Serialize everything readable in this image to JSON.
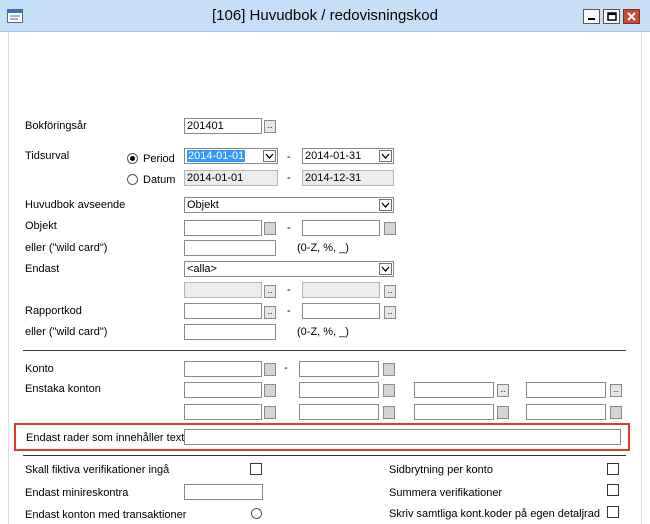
{
  "window": {
    "title": "[106]  Huvudbok / redovisningskod",
    "minimize_icon": "minimize-icon",
    "maximize_icon": "maximize-icon",
    "close_icon": "close-icon",
    "accent": "#c7def7",
    "close_color": "#c94b3a"
  },
  "form": {
    "bokforingsar_label": "Bokföringsår",
    "bokforingsar_value": "201401",
    "tidsurval_label": "Tidsurval",
    "period_label": "Period",
    "datum_label": "Datum",
    "period_from": "2014-01-01",
    "period_to": "2014-01-31",
    "datum_from": "2014-01-01",
    "datum_to": "2014-12-31",
    "huvudbok_label": "Huvudbok avseende",
    "huvudbok_value": "Objekt",
    "objekt_label": "Objekt",
    "wildcard_label": "eller (\"wild card\")",
    "wildcard_hint": "(0-Z, %, _)",
    "endast_label": "Endast",
    "endast_value": "<alla>",
    "rapportkod_label": "Rapportkod",
    "wildcard2_label": "eller (\"wild card\")",
    "wildcard2_hint": "(0-Z, %, _)",
    "dash": "-",
    "dots_label": "..",
    "konto_label": "Konto",
    "enstaka_label": "Enstaka konton",
    "text_filter_label": "Endast rader som innehåller text",
    "text_filter_value": "",
    "highlight_color": "#e03a2f",
    "fiktiva_label": "Skall fiktiva verifikationer ingå",
    "minireskontra_label": "Endast minireskontra",
    "transaktioner_label": "Endast konton med transaktioner",
    "sidbrytning_label": "Sidbrytning per konto",
    "summera_label": "Summera verifikationer",
    "skriv_label": "Skriv samtliga kont.koder på egen detaljrad"
  }
}
